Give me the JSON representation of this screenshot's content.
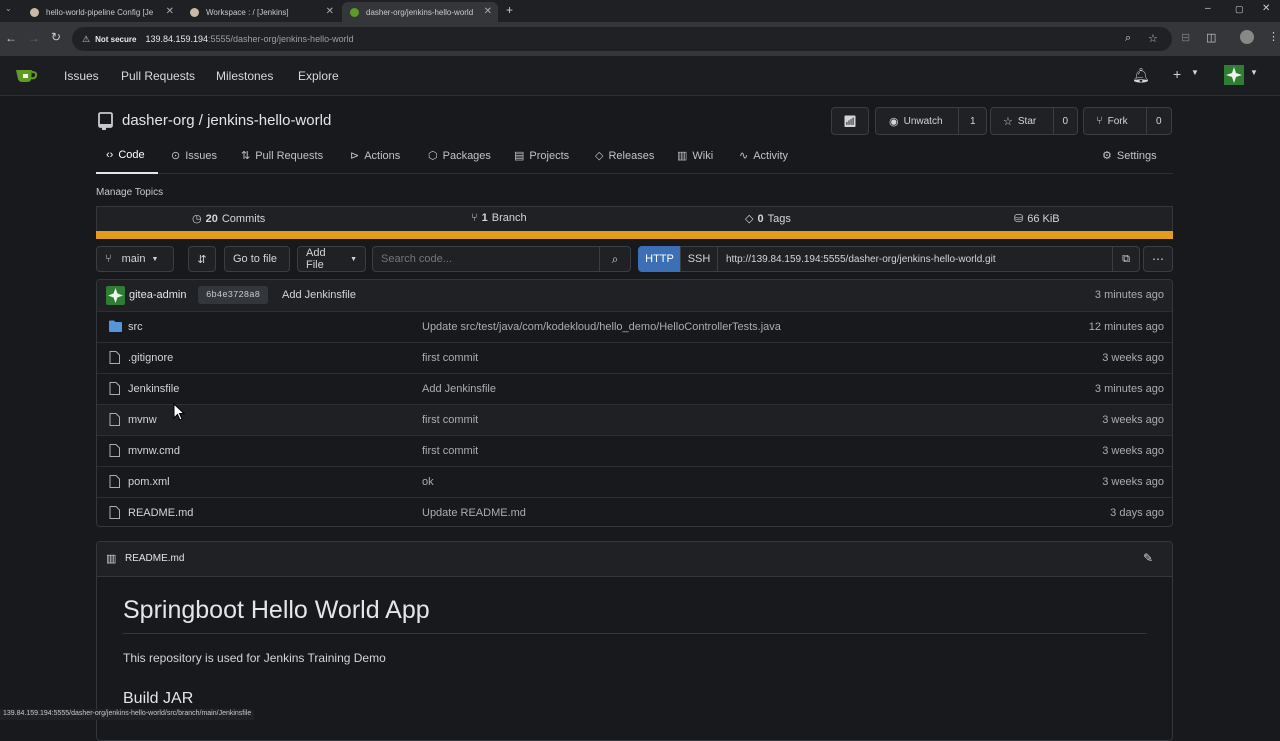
{
  "browser": {
    "tabs": [
      {
        "title": "hello-world-pipeline Config [Je"
      },
      {
        "title": "Workspace : / [Jenkins]"
      },
      {
        "title": "dasher-org/jenkins-hello-world"
      }
    ],
    "security_label": "Not secure",
    "url_host": "139.84.159.194",
    "url_path": ":5555/dasher-org/jenkins-hello-world"
  },
  "nav": {
    "items": [
      "Issues",
      "Pull Requests",
      "Milestones",
      "Explore"
    ]
  },
  "repo": {
    "owner": "dasher-org",
    "separator": "/",
    "name": "jenkins-hello-world",
    "unwatch_label": "Unwatch",
    "watch_count": "1",
    "star_label": "Star",
    "star_count": "0",
    "fork_label": "Fork",
    "fork_count": "0"
  },
  "repo_tabs": [
    "Code",
    "Issues",
    "Pull Requests",
    "Actions",
    "Packages",
    "Projects",
    "Releases",
    "Wiki",
    "Activity"
  ],
  "settings_label": "Settings",
  "manage_topics": "Manage Topics",
  "stats": {
    "commits_count": "20",
    "commits_label": "Commits",
    "branch_count": "1",
    "branch_label": "Branch",
    "tags_count": "0",
    "tags_label": "Tags",
    "size": "66 KiB"
  },
  "language_color": "#e19d1b",
  "toolbar": {
    "branch": "main",
    "go_to_file": "Go to file",
    "add_file": "Add File",
    "search_placeholder": "Search code...",
    "http": "HTTP",
    "ssh": "SSH",
    "clone_url": "http://139.84.159.194:5555/dasher-org/jenkins-hello-world.git"
  },
  "latest_commit": {
    "author": "gitea-admin",
    "sha": "6b4e3728a8",
    "message": "Add Jenkinsfile",
    "age": "3 minutes ago"
  },
  "files": [
    {
      "name": "src",
      "type": "dir",
      "message": "Update src/test/java/com/kodekloud/hello_demo/HelloControllerTests.java",
      "age": "12 minutes ago"
    },
    {
      "name": ".gitignore",
      "type": "file",
      "message": "first commit",
      "age": "3 weeks ago"
    },
    {
      "name": "Jenkinsfile",
      "type": "file",
      "message": "Add Jenkinsfile",
      "age": "3 minutes ago"
    },
    {
      "name": "mvnw",
      "type": "file",
      "message": "first commit",
      "age": "3 weeks ago"
    },
    {
      "name": "mvnw.cmd",
      "type": "file",
      "message": "first commit",
      "age": "3 weeks ago"
    },
    {
      "name": "pom.xml",
      "type": "file",
      "message": "ok",
      "age": "3 weeks ago"
    },
    {
      "name": "README.md",
      "type": "file",
      "message": "Update README.md",
      "age": "3 days ago"
    }
  ],
  "readme": {
    "filename": "README.md",
    "h1": "Springboot Hello World App",
    "p": "This repository is used for Jenkins Training Demo",
    "h2": "Build JAR"
  },
  "status_url": "139.84.159.194:5555/dasher-org/jenkins-hello-world/src/branch/main/Jenkinsfile"
}
